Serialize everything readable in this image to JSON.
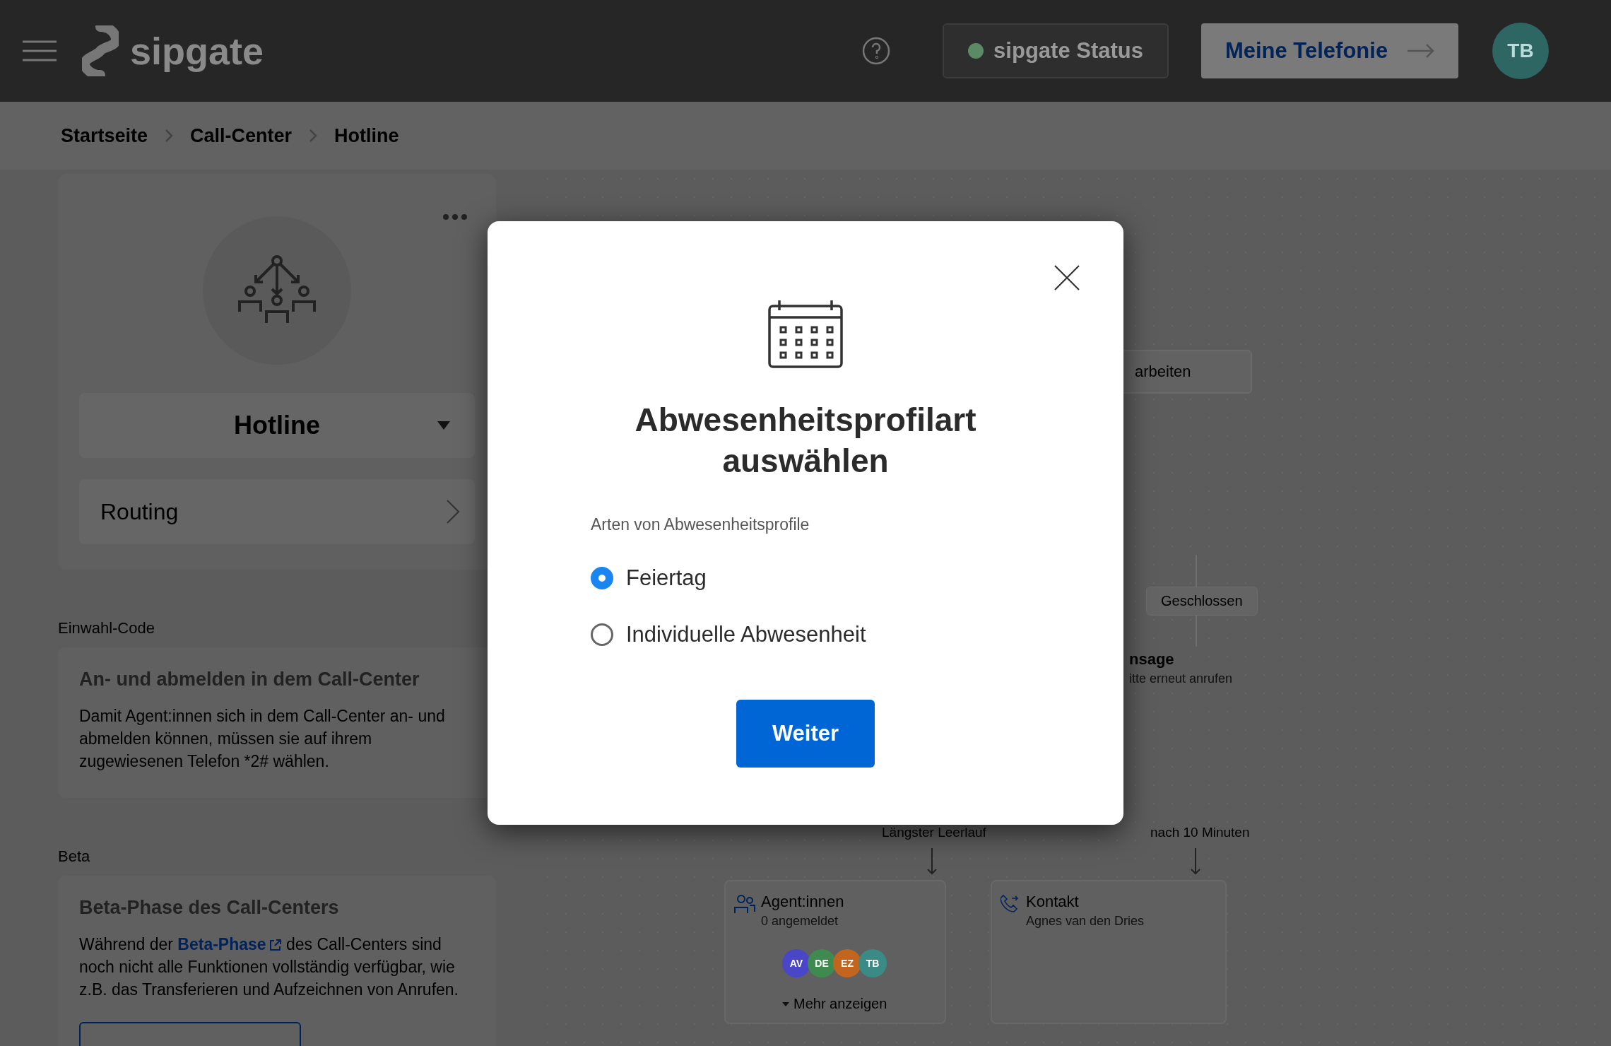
{
  "header": {
    "logo_text": "sipgate",
    "status_button": "sipgate Status",
    "telephony_button": "Meine Telefonie",
    "avatar_initials": "TB"
  },
  "breadcrumb": [
    {
      "label": "Startseite"
    },
    {
      "label": "Call-Center"
    },
    {
      "label": "Hotline"
    }
  ],
  "call_center": {
    "name": "Hotline",
    "menu_items": [
      {
        "label": "Routing"
      }
    ]
  },
  "sections": [
    {
      "label": "Einwahl-Code",
      "title": "An- und abmelden in dem Call-Center",
      "text_before": "Damit Agent:innen sich in dem Call-Center an- und abmelden können, müssen sie auf ihrem zugewiesenen Telefon *2# wählen."
    },
    {
      "label": "Beta",
      "title": "Beta-Phase des Call-Centers",
      "text_before": "Während der",
      "link": "Beta-Phase",
      "text_after": "des Call-Centers sind noch nicht alle Funktionen vollständig verfügbar, wie z.B. das Transferieren und Aufzeichnen von Anrufen."
    }
  ],
  "diagram": {
    "edit_button": "arbeiten",
    "closed_node": "Geschlossen",
    "announcement_title": "nsage",
    "announcement_text": "itte erneut anrufen",
    "edges": [
      {
        "label": "Längster Leerlauf"
      },
      {
        "label": "nach 10 Minuten"
      }
    ],
    "agents": {
      "title": "Agent:innen",
      "subtitle": "0 angemeldet",
      "more": "Mehr anzeigen",
      "avatars": [
        {
          "initials": "AV",
          "color": "#4a46c8"
        },
        {
          "initials": "DE",
          "color": "#3f8a4f"
        },
        {
          "initials": "EZ",
          "color": "#c2651f"
        },
        {
          "initials": "TB",
          "color": "#3a8a86"
        }
      ]
    },
    "contact": {
      "title": "Kontakt",
      "subtitle": "Agnes van den Dries"
    }
  },
  "modal": {
    "title": "Abwesenheitsprofilart auswählen",
    "group_label": "Arten von Abwesenheitsprofile",
    "options": [
      {
        "label": "Feiertag",
        "selected": true
      },
      {
        "label": "Individuelle Abwesenheit",
        "selected": false
      }
    ],
    "submit_button": "Weiter"
  }
}
